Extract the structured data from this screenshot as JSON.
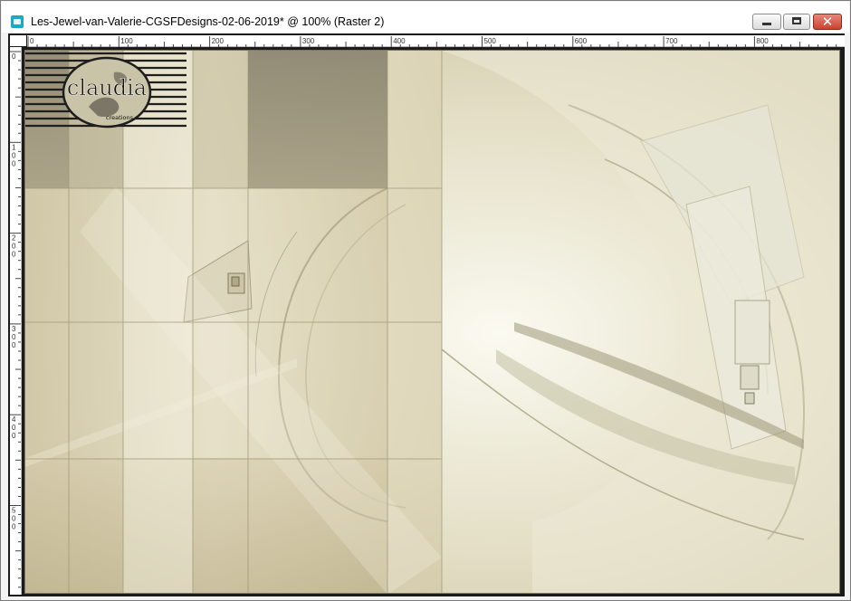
{
  "window": {
    "title": "Les-Jewel-van-Valerie-CGSFDesigns-02-06-2019* @ 100% (Raster 2)",
    "buttons": {
      "minimize": "minimize-icon",
      "maximize": "maximize-icon",
      "close": "close-icon"
    },
    "close_glyph": "✕"
  },
  "rulers": {
    "top_labels": [
      "0",
      "100",
      "200",
      "300",
      "400",
      "500",
      "600",
      "700",
      "800"
    ],
    "left_labels": [
      "0",
      "100",
      "200",
      "300",
      "400",
      "500"
    ]
  },
  "canvas": {
    "watermark_text": "claudia",
    "watermark_subtext": "creations"
  },
  "colors": {
    "canvas_light": "#f1efe0",
    "canvas_tan": "#c8bd98",
    "canvas_dark": "#7a7560",
    "workspace": "#1b1b1b",
    "close_button": "#c8432f"
  }
}
